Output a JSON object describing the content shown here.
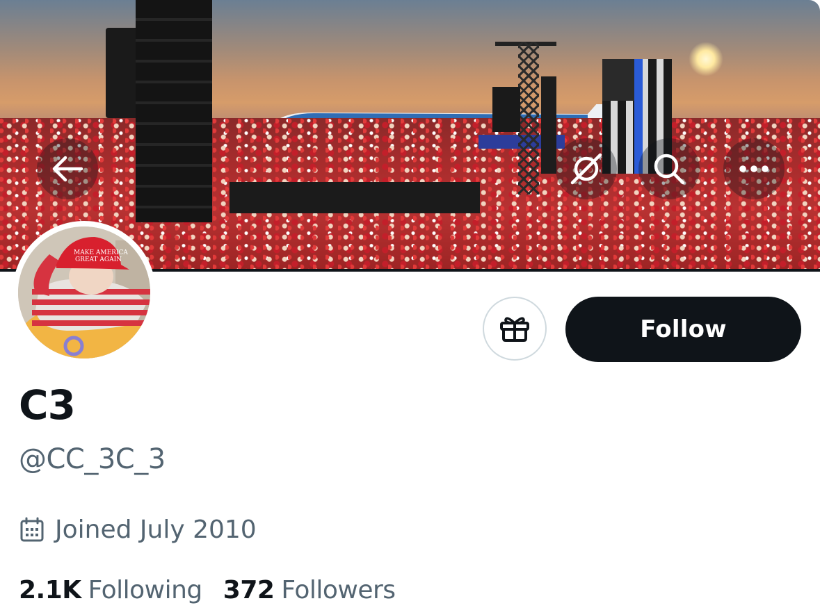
{
  "banner": {
    "image_alt": "profile-header-photo",
    "back_icon": "arrow-left-icon",
    "grok_icon": "grok-icon",
    "search_icon": "search-icon",
    "more_icon": "more-horizontal-icon"
  },
  "profile": {
    "display_name": "C3",
    "handle": "@CC_3C_3",
    "joined": "Joined July 2010",
    "avatar_icon": "avatar"
  },
  "actions": {
    "gift_icon": "gift-icon",
    "follow_label": "Follow"
  },
  "stats": {
    "following_count": "2.1K",
    "following_label": "Following",
    "followers_count": "372",
    "followers_label": "Followers"
  },
  "colors": {
    "text_primary": "#0f1419",
    "text_secondary": "#536471",
    "follow_bg": "#0f1419",
    "follow_text": "#ffffff",
    "border": "#cfd9de"
  }
}
